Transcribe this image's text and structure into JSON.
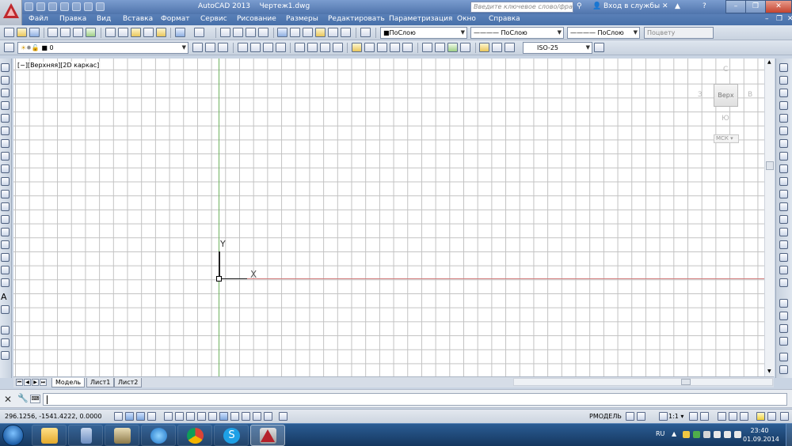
{
  "window": {
    "app_title": "AutoCAD 2013",
    "document_title": "Чертеж1.dwg",
    "search_placeholder": "Введите ключевое слово/фразу",
    "signin_label": "Вход в службы",
    "minimize": "–",
    "restore": "❐",
    "close": "✕"
  },
  "menu": {
    "items": [
      "Файл",
      "Правка",
      "Вид",
      "Вставка",
      "Формат",
      "Сервис",
      "Рисование",
      "Размеры",
      "Редактировать",
      "Параметризация",
      "Окно",
      "Справка"
    ]
  },
  "toolbar": {
    "color_combo": "■ПоСлою",
    "linetype_combo": "———— ПоСлою",
    "lineweight_combo": "———— ПоСлою",
    "plotstyle_combo": "Поцвету",
    "layer_combo": "0",
    "dimstyle_combo": "ISO-25"
  },
  "drawing": {
    "viewport_label": "[−][Верхняя][2D каркас]",
    "ucs_x_label": "X",
    "ucs_y_label": "Y",
    "viewcube": {
      "face": "Верх",
      "north": "С",
      "south": "Ю",
      "west": "З",
      "east": "В",
      "wcs": "МСК ▾"
    }
  },
  "tabs": {
    "items": [
      "Модель",
      "Лист1",
      "Лист2"
    ],
    "active": "Модель"
  },
  "command": {
    "prompt_icon": "⌨",
    "value": ""
  },
  "status": {
    "coordinates": "296.1256, -1541.4222, 0.0000",
    "model_label": "РМОДЕЛЬ",
    "scale_label": "1:1 ▾"
  },
  "taskbar": {
    "language": "RU",
    "time": "23:40",
    "date": "01.09.2014"
  },
  "colors": {
    "title_bar": "#4f74ac",
    "menu_bar": "#4770a9",
    "grid": "#c2c2c2",
    "y_axis": "#6eb35f",
    "x_axis": "#d27b7b",
    "taskbar": "#15375f"
  }
}
